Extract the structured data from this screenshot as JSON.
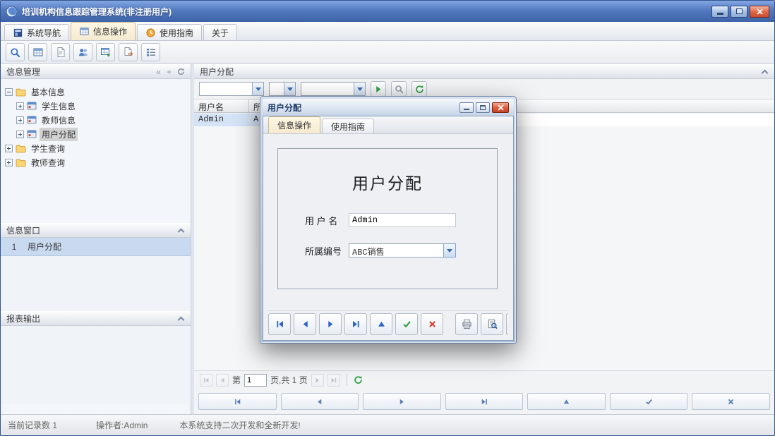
{
  "window": {
    "title": "培训机构信息跟踪管理系统(非注册用户)"
  },
  "icons": {
    "collapse_left": "«",
    "plus": "+"
  },
  "tabbar": {
    "tabs": [
      {
        "label": "系统导航"
      },
      {
        "label": "信息操作"
      },
      {
        "label": "使用指南"
      },
      {
        "label": "关于"
      }
    ]
  },
  "toolbar": {
    "icon_names": [
      "search",
      "table",
      "new-document",
      "users",
      "table-edit",
      "export",
      "list"
    ]
  },
  "sidebar": {
    "info_panel": {
      "title": "信息管理"
    },
    "tree": {
      "root_label": "基本信息",
      "items": [
        {
          "label": "学生信息"
        },
        {
          "label": "教师信息"
        },
        {
          "label": "用户分配"
        }
      ],
      "folders": [
        {
          "label": "学生查询"
        },
        {
          "label": "教师查询"
        }
      ]
    },
    "window_panel": {
      "title": "信息窗口",
      "items": [
        {
          "index": "1",
          "label": "用户分配"
        }
      ]
    },
    "report_panel": {
      "title": "报表输出"
    }
  },
  "main": {
    "title": "用户分配",
    "filters": {
      "combo1": "",
      "combo2": "",
      "combo3": ""
    },
    "grid": {
      "columns": [
        {
          "label": "用户名"
        },
        {
          "label": "所"
        }
      ],
      "rows": [
        {
          "username": "Admin",
          "dept": "A"
        }
      ]
    },
    "pagination": {
      "page_label": "第",
      "page_value": "1",
      "total_label": "页,共 1 页"
    }
  },
  "dialog": {
    "title": "用户分配",
    "tabs": [
      {
        "label": "信息操作"
      },
      {
        "label": "使用指南"
      }
    ],
    "form": {
      "heading": "用户分配",
      "username_label": "用 户 名",
      "username_value": "Admin",
      "dept_label": "所属编号",
      "dept_value": "ABC销售"
    }
  },
  "statusbar": {
    "record_count": "当前记录数 1",
    "operator": "操作者:Admin",
    "message": "本系统支持二次开发和全新开发!"
  }
}
